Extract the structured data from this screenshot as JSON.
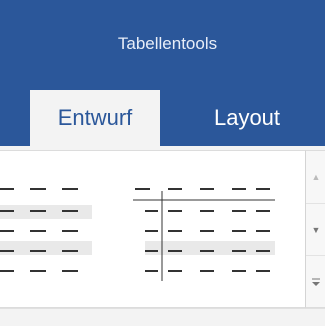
{
  "ribbon": {
    "context_title": "Tabellentools",
    "tabs": [
      {
        "label": "Entwurf",
        "active": true
      },
      {
        "label": "Layout",
        "active": false
      }
    ],
    "accent_color": "#2b579a"
  },
  "table_styles_gallery": {
    "styles": [
      {
        "name": "table-style-plain-dashed"
      },
      {
        "name": "table-style-header-column-lines"
      }
    ],
    "scroll_buttons": [
      "scroll-up-icon",
      "scroll-down-icon",
      "gallery-more-icon"
    ]
  }
}
